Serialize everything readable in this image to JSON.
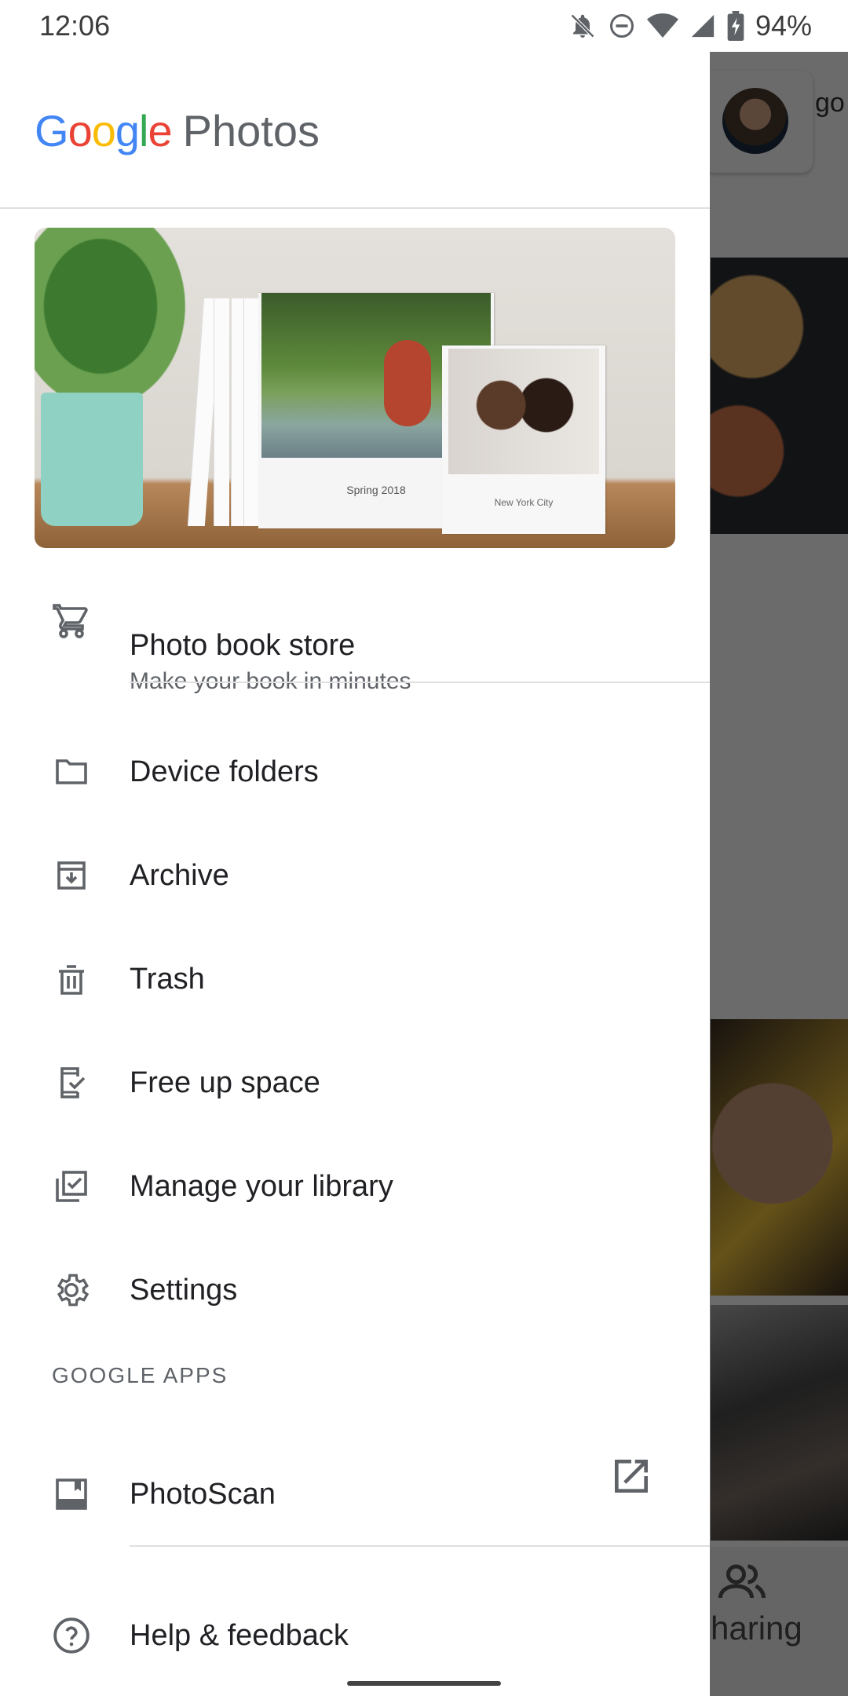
{
  "status_bar": {
    "time": "12:06",
    "battery_percent": "94%",
    "icons": [
      "bell-off-icon",
      "do-not-disturb-icon",
      "wifi-icon",
      "signal-icon",
      "battery-charging-icon"
    ]
  },
  "background": {
    "avatar_card_text": "go",
    "sharing_label": "haring"
  },
  "drawer": {
    "logo": {
      "google_letters": [
        "G",
        "o",
        "o",
        "g",
        "l",
        "e"
      ],
      "product": "Photos"
    },
    "promo": {
      "book_caption": "Spring 2018",
      "second_book_caption": "New York City"
    },
    "photo_book": {
      "title": "Photo book store",
      "subtitle": "Make your book in minutes",
      "icon": "cart-icon"
    },
    "items": [
      {
        "label": "Device folders",
        "icon": "folder-icon"
      },
      {
        "label": "Archive",
        "icon": "archive-icon"
      },
      {
        "label": "Trash",
        "icon": "trash-icon"
      },
      {
        "label": "Free up space",
        "icon": "phone-check-icon"
      },
      {
        "label": "Manage your library",
        "icon": "library-check-icon"
      },
      {
        "label": "Settings",
        "icon": "gear-icon"
      }
    ],
    "section_google_apps": "GOOGLE APPS",
    "photoscan": {
      "label": "PhotoScan",
      "icon": "photoscan-icon",
      "external_icon": "open-external-icon"
    },
    "help": {
      "label": "Help & feedback",
      "icon": "help-circle-icon"
    }
  }
}
